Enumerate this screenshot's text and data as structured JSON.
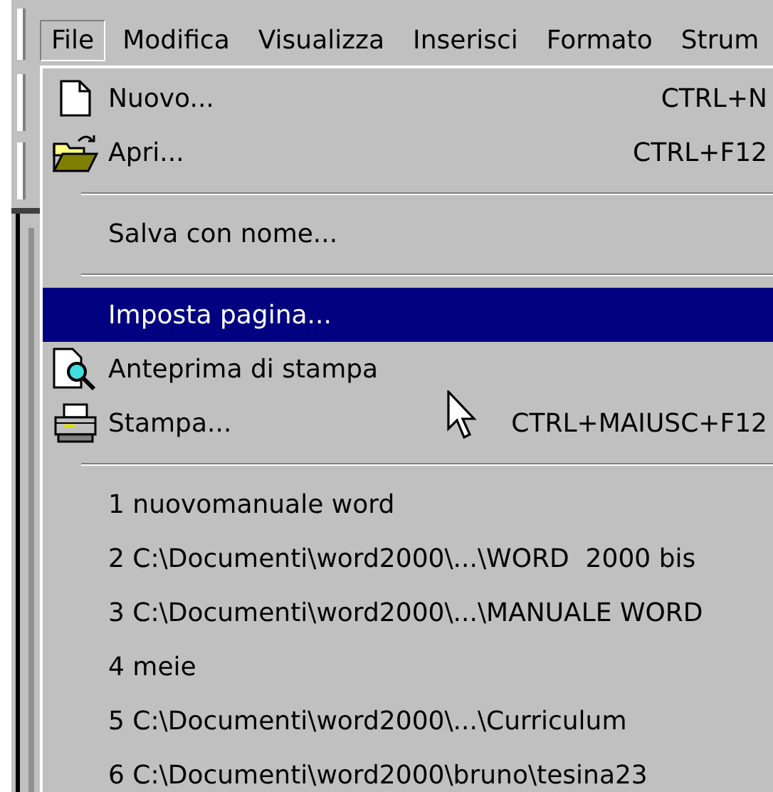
{
  "menu_bar": [
    {
      "label": "File",
      "open": true
    },
    {
      "label": "Modifica",
      "open": false
    },
    {
      "label": "Visualizza",
      "open": false
    },
    {
      "label": "Inserisci",
      "open": false
    },
    {
      "label": "Formato",
      "open": false
    },
    {
      "label": "Strum",
      "open": false
    }
  ],
  "file_menu": {
    "items": [
      {
        "kind": "command",
        "label": "Nuovo...",
        "shortcut": "CTRL+N",
        "selected": false
      },
      {
        "kind": "command",
        "label": "Apri...",
        "shortcut": "CTRL+F12",
        "selected": false
      },
      {
        "kind": "separator"
      },
      {
        "kind": "command",
        "label": "Salva con nome...",
        "selected": false
      },
      {
        "kind": "separator"
      },
      {
        "kind": "command",
        "label": "Imposta pagina...",
        "selected": true
      },
      {
        "kind": "command",
        "label": "Anteprima di stampa",
        "selected": false
      },
      {
        "kind": "command",
        "label": "Stampa...",
        "shortcut": "CTRL+MAIUSC+F12",
        "selected": false
      },
      {
        "kind": "separator"
      },
      {
        "kind": "recent",
        "label": "1 nuovomanuale word",
        "selected": false
      },
      {
        "kind": "recent",
        "label": "2 C:\\Documenti\\word2000\\...\\WORD  2000 bis",
        "selected": false
      },
      {
        "kind": "recent",
        "label": "3 C:\\Documenti\\word2000\\...\\MANUALE WORD",
        "selected": false
      },
      {
        "kind": "recent",
        "label": "4 meie",
        "selected": false
      },
      {
        "kind": "recent",
        "label": "5 C:\\Documenti\\word2000\\...\\Curriculum",
        "selected": false
      },
      {
        "kind": "recent",
        "label": "6 C:\\Documenti\\word2000\\bruno\\tesina23",
        "selected": false
      }
    ]
  }
}
